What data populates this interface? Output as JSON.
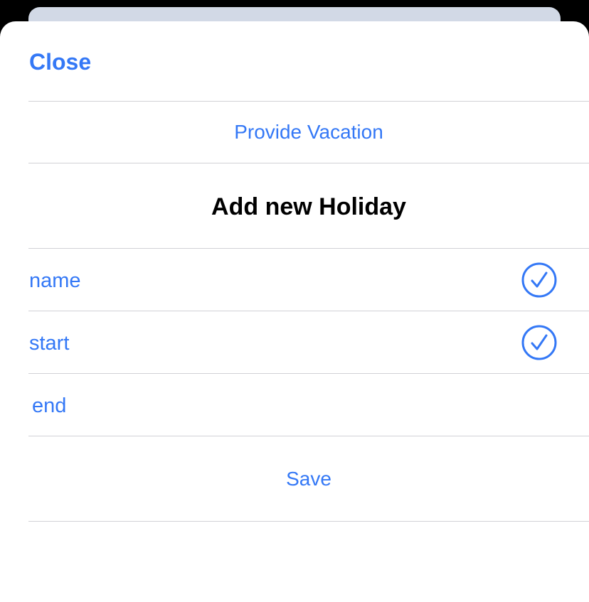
{
  "header": {
    "close_label": "Close"
  },
  "actions": {
    "provide_vacation_label": "Provide Vacation",
    "save_label": "Save"
  },
  "form": {
    "title": "Add new Holiday",
    "fields": [
      {
        "label": "name",
        "checked": true
      },
      {
        "label": "start",
        "checked": true
      },
      {
        "label": "end",
        "checked": false
      }
    ]
  },
  "icons": {
    "checkmark": "checkmark-circle-icon"
  },
  "colors": {
    "accent": "#3478f6",
    "divider": "#d1d1d6",
    "sheet_background": "#ffffff",
    "backdrop": "#000000"
  }
}
